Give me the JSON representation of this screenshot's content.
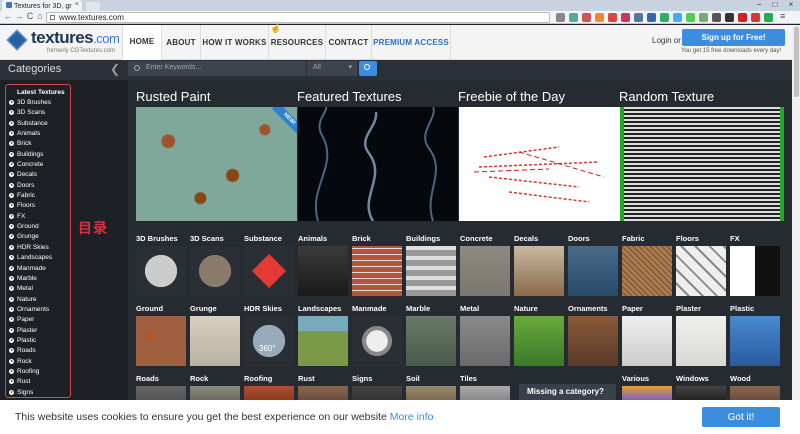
{
  "browser": {
    "tab_title": "Textures for 3D, gr",
    "url": "www.textures.com",
    "tab_close": "×",
    "win_controls": [
      "−",
      "□",
      "×"
    ],
    "nav_buttons": [
      "←",
      "→",
      "C",
      "⌂"
    ]
  },
  "header": {
    "logo_main": "textures",
    "logo_suffix": ".com",
    "logo_sub": "formerly CGTextures.com",
    "nav": [
      "HOME",
      "ABOUT",
      "HOW IT WORKS",
      "RESOURCES",
      "CONTACT",
      "PREMIUM ACCESS"
    ],
    "login": "Login or",
    "signup": "Sign up for Free!",
    "signup_note": "You get 15 free downloads every day!"
  },
  "search": {
    "categories_title": "Categories",
    "chevron": "❮",
    "placeholder": "Enter Keywords...",
    "filter": "All",
    "filter_caret": "▾"
  },
  "sidebar": {
    "items": [
      "Latest Textures",
      "3D Brushes",
      "3D Scans",
      "Substance",
      "Animals",
      "Brick",
      "Buildings",
      "Concrete",
      "Decals",
      "Doors",
      "Fabric",
      "Floors",
      "FX",
      "Ground",
      "Grunge",
      "HDR Skies",
      "Landscapes",
      "Manmade",
      "Marble",
      "Metal",
      "Nature",
      "Ornaments",
      "Paper",
      "Plaster",
      "Plastic",
      "Roads",
      "Rock",
      "Roofing",
      "Rust",
      "Signs"
    ]
  },
  "annotation": "目录",
  "featured": {
    "titles": [
      "Rusted Paint",
      "Featured Textures",
      "Freebie of the Day",
      "Random Texture"
    ],
    "badge": "NEW!"
  },
  "grid": {
    "row1": [
      "3D Brushes",
      "3D Scans",
      "Substance",
      "Animals",
      "Brick",
      "Buildings",
      "Concrete",
      "Decals",
      "Doors",
      "Fabric",
      "Floors",
      "FX"
    ],
    "row2": [
      "Ground",
      "Grunge",
      "HDR Skies",
      "Landscapes",
      "Manmade",
      "Marble",
      "Metal",
      "Nature",
      "Ornaments",
      "Paper",
      "Plaster",
      "Plastic"
    ],
    "row3": [
      "Roads",
      "Rock",
      "Roofing",
      "Rust",
      "Signs",
      "Soil",
      "Tiles",
      "",
      "",
      "Various",
      "Windows",
      "Wood"
    ],
    "hdr_label": "360°",
    "missing": "Missing a category?"
  },
  "cookie": {
    "text": "This website uses cookies to ensure you get the best experience on our website",
    "link": "More info",
    "button": "Got it!"
  },
  "colors": {
    "accent": "#3b8de0",
    "annotation": "#d9464e",
    "bg": "#1d2126"
  }
}
